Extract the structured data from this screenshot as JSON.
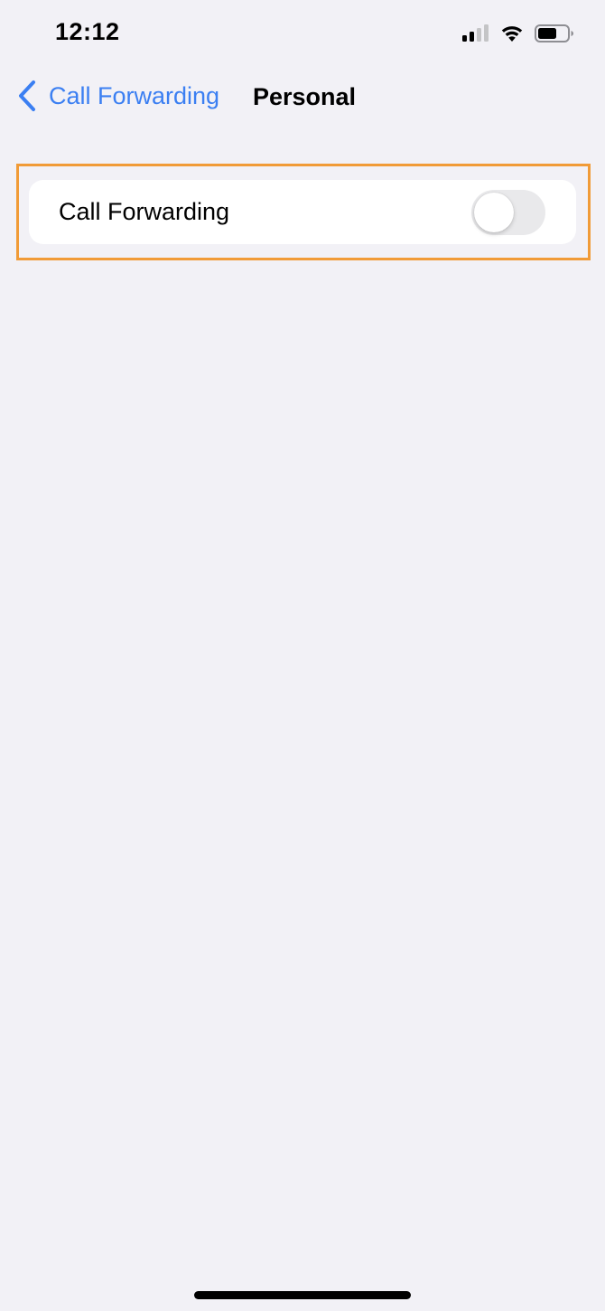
{
  "status_bar": {
    "time": "12:12",
    "icons": [
      "signal-icon",
      "wifi-icon",
      "battery-icon"
    ]
  },
  "nav": {
    "back_label": "Call Forwarding",
    "title": "Personal",
    "back_icon": "chevron-left-icon"
  },
  "settings": {
    "call_forwarding_label": "Call Forwarding",
    "call_forwarding_enabled": false
  },
  "colors": {
    "accent": "#3b7ff2",
    "background": "#f2f1f6",
    "highlight": "#f19b37",
    "toggle_off": "#e9e9eb"
  }
}
